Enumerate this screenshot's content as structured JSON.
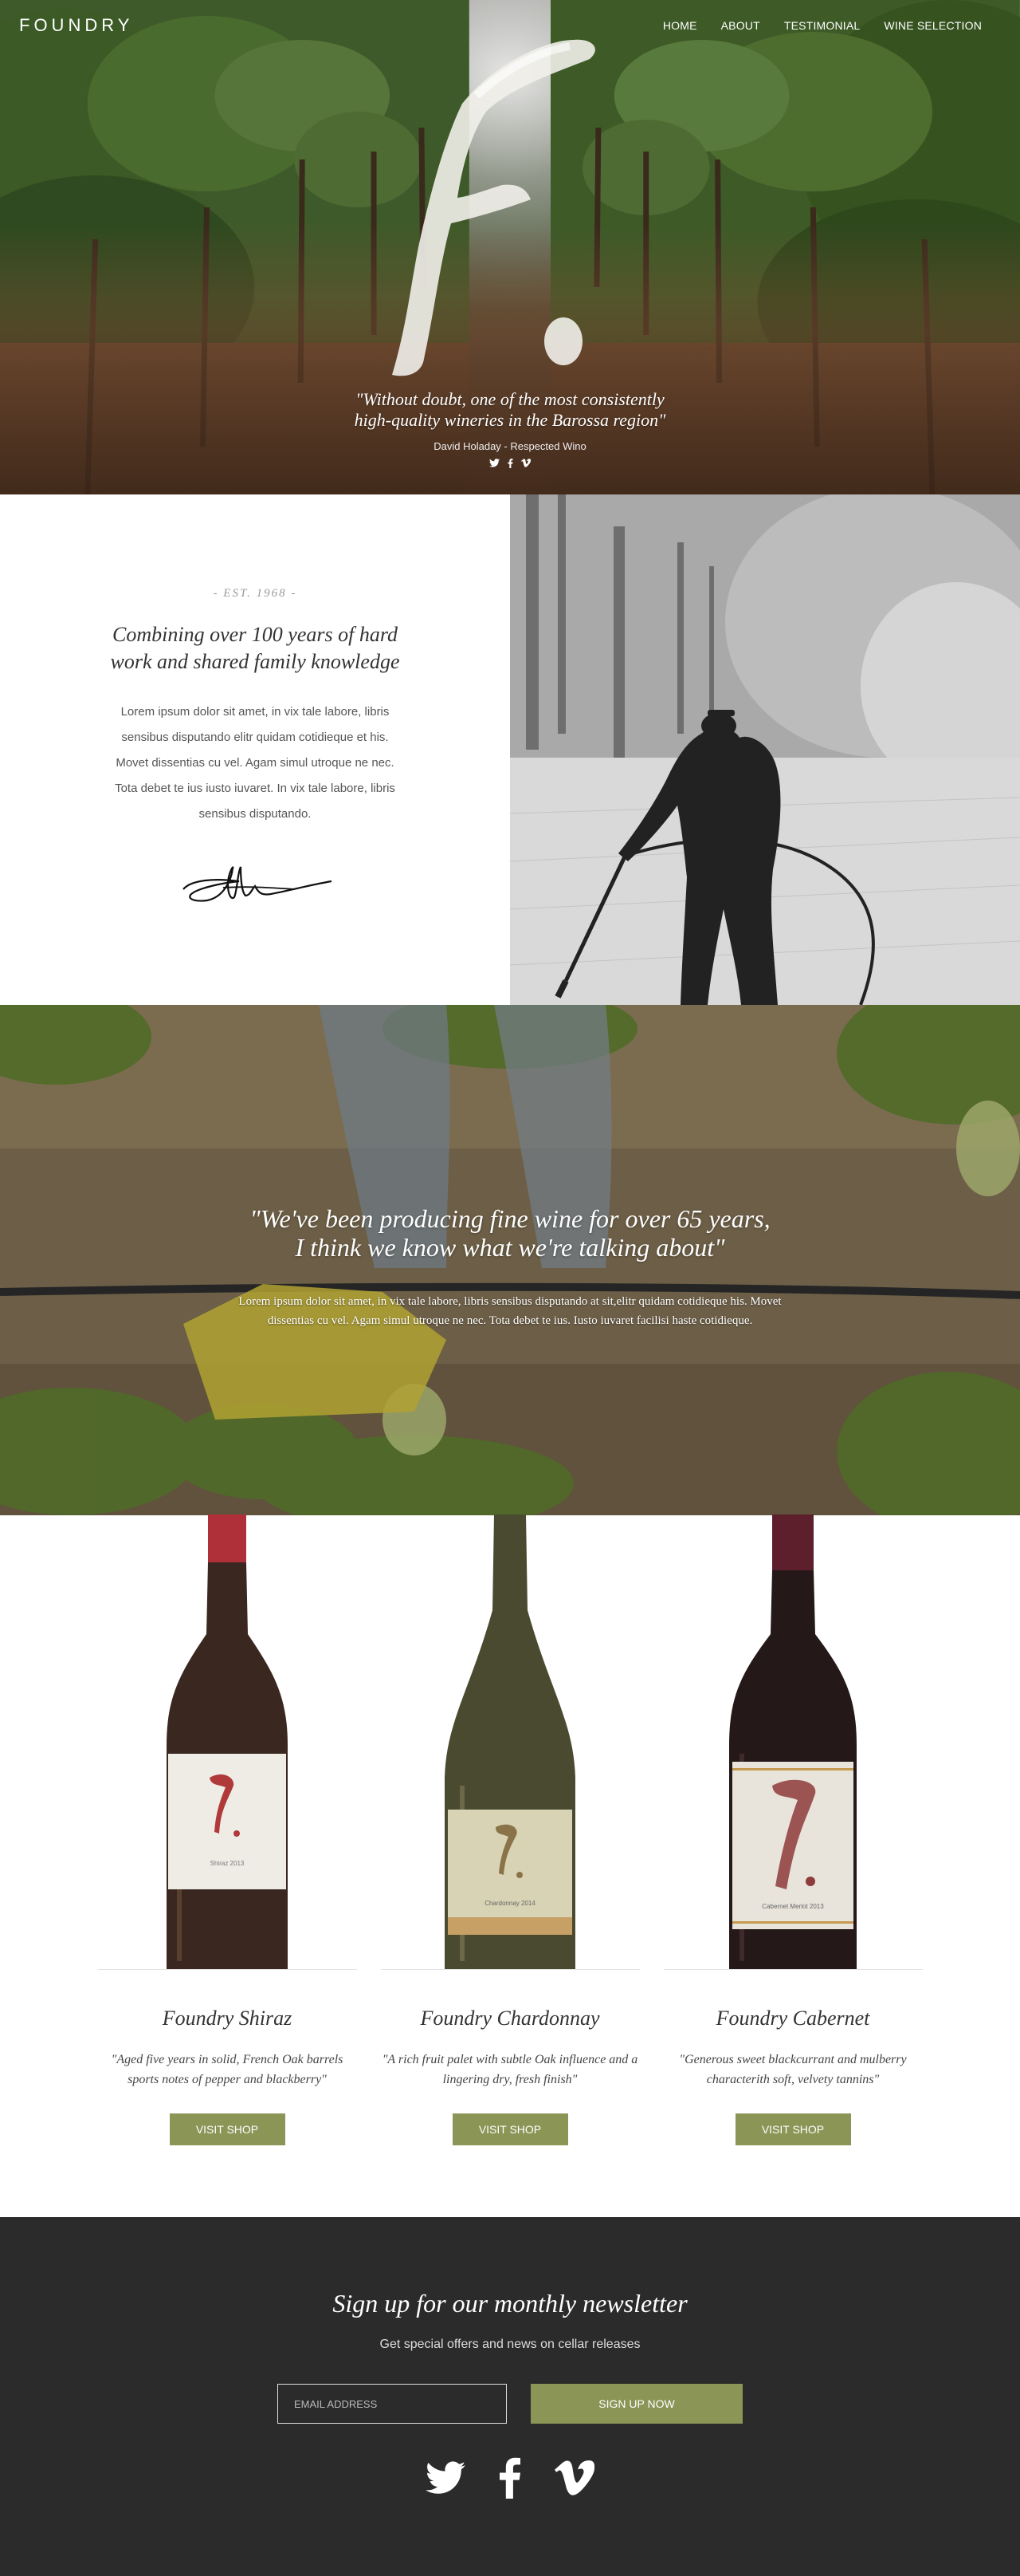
{
  "header": {
    "logo": "FOUNDRY",
    "nav": [
      "HOME",
      "ABOUT",
      "TESTIMONIAL",
      "WINE SELECTION"
    ]
  },
  "hero": {
    "quote_line1": "\"Without doubt, one of the most consistently",
    "quote_line2": "high-quality wineries in the Barossa region\"",
    "citation": "David Holaday - Respected Wino",
    "social_icons": [
      "twitter-icon",
      "facebook-icon",
      "vimeo-icon"
    ]
  },
  "about": {
    "est": "- EST. 1968 -",
    "title": "Combining over 100 years of hard work and shared family knowledge",
    "body": "Lorem ipsum dolor sit amet, in vix tale labore, libris sensibus disputando elitr quidam cotidieque et his. Movet dissentias cu vel. Agam simul utroque ne nec. Tota debet te ius iusto iuvaret. In vix tale labore, libris sensibus disputando."
  },
  "band": {
    "quote_line1": "\"We've been producing fine wine for over 65 years,",
    "quote_line2": "I think we know what we're talking about\"",
    "body": "Lorem ipsum dolor sit amet, in vix tale labore, libris sensibus disputando at sit,elitr quidam cotidieque his. Movet dissentias cu vel. Agam simul utroque ne nec. Tota debet te ius. Iusto iuvaret facilisi haste cotidieque."
  },
  "products": [
    {
      "name": "Foundry Shiraz",
      "desc": "\"Aged five years in solid, French Oak barrels sports notes of pepper and blackberry\"",
      "button": "VISIT SHOP",
      "label_text": "Shiraz 2013"
    },
    {
      "name": "Foundry Chardonnay",
      "desc": "\"A rich fruit palet with subtle Oak influence and a lingering dry, fresh finish\"",
      "button": "VISIT SHOP",
      "label_text": "Chardonnay 2014"
    },
    {
      "name": "Foundry Cabernet",
      "desc": "\"Generous sweet blackcurrant and mulberry characterith soft, velvety tannins\"",
      "button": "VISIT SHOP",
      "label_text": "Cabernet Merlot 2013"
    }
  ],
  "newsletter": {
    "title": "Sign up for our monthly newsletter",
    "subtitle": "Get special offers and news on cellar releases",
    "email_placeholder": "EMAIL ADDRESS",
    "button": "SIGN UP NOW",
    "social_icons": [
      "twitter-icon",
      "facebook-icon",
      "vimeo-icon"
    ]
  },
  "colors": {
    "accent": "#8a9556",
    "newsletter_bg": "#2b2b2b"
  }
}
